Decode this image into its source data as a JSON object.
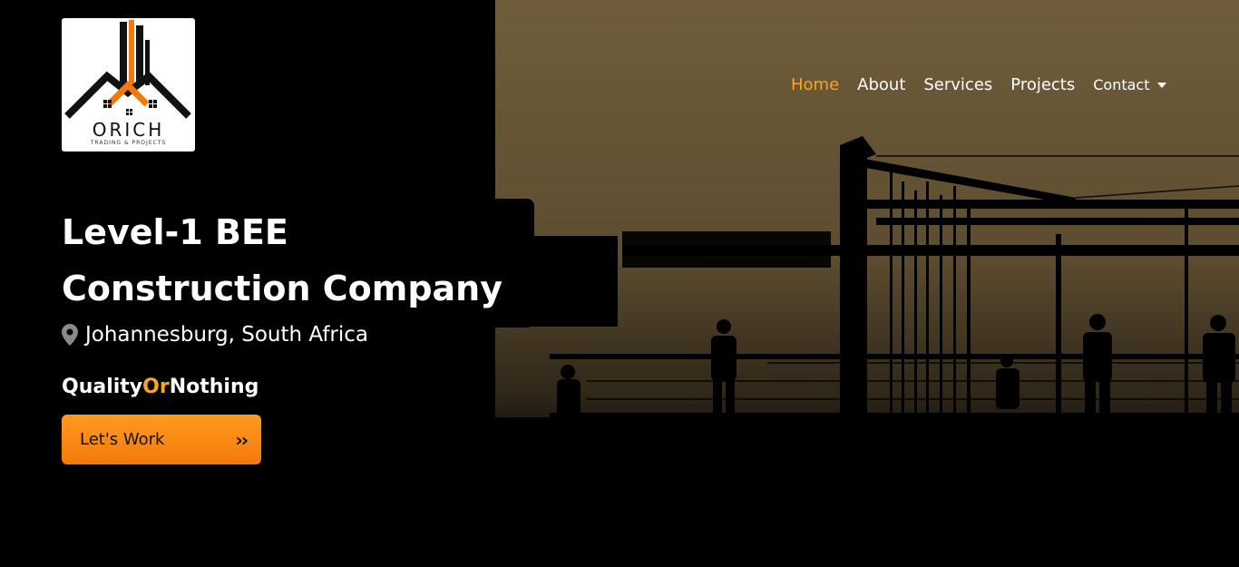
{
  "brand": {
    "name": "ORICH",
    "subtitle": "TRADING & PROJECTS",
    "logo_icon": "building-roof-logo",
    "accent_color": "#f5a623"
  },
  "nav": {
    "items": [
      {
        "label": "Home",
        "active": true
      },
      {
        "label": "About"
      },
      {
        "label": "Services"
      },
      {
        "label": "Projects"
      },
      {
        "label": "Contact",
        "icon": "caret-down-icon"
      }
    ]
  },
  "hero": {
    "headline_line1": "Level-1 BEE",
    "headline_line2": "Construction Company",
    "location_icon": "map-pin-icon",
    "location": "Johannesburg, South Africa",
    "tagline_part1": "Quality",
    "tagline_part2": "Or",
    "tagline_part3": "Nothing",
    "cta_label": "Let's Work",
    "cta_icon": "double-chevron-right-icon",
    "background_image": "construction-site-silhouette"
  }
}
